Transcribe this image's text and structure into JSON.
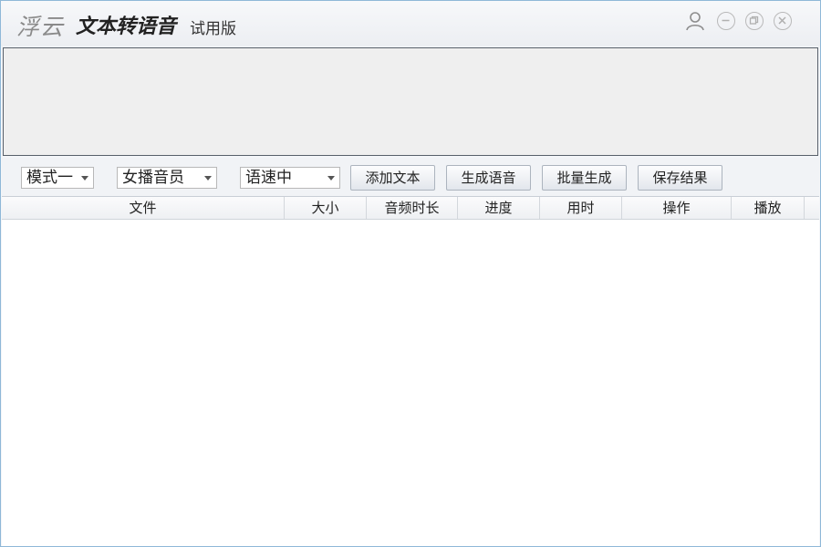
{
  "titlebar": {
    "brand": "浮云",
    "title": "文本转语音",
    "edition": "试用版",
    "icons": [
      "user-icon",
      "minimize-icon",
      "restore-icon",
      "close-icon"
    ]
  },
  "text_input": {
    "value": ""
  },
  "toolbar": {
    "mode_select": {
      "value": "模式一"
    },
    "voice_select": {
      "value": "女播音员"
    },
    "speed_select": {
      "value": "语速中"
    },
    "add_text_label": "添加文本",
    "generate_label": "生成语音",
    "batch_label": "批量生成",
    "save_label": "保存结果"
  },
  "table": {
    "columns": [
      "文件",
      "大小",
      "音频时长",
      "进度",
      "用时",
      "操作",
      "播放"
    ],
    "rows": []
  }
}
